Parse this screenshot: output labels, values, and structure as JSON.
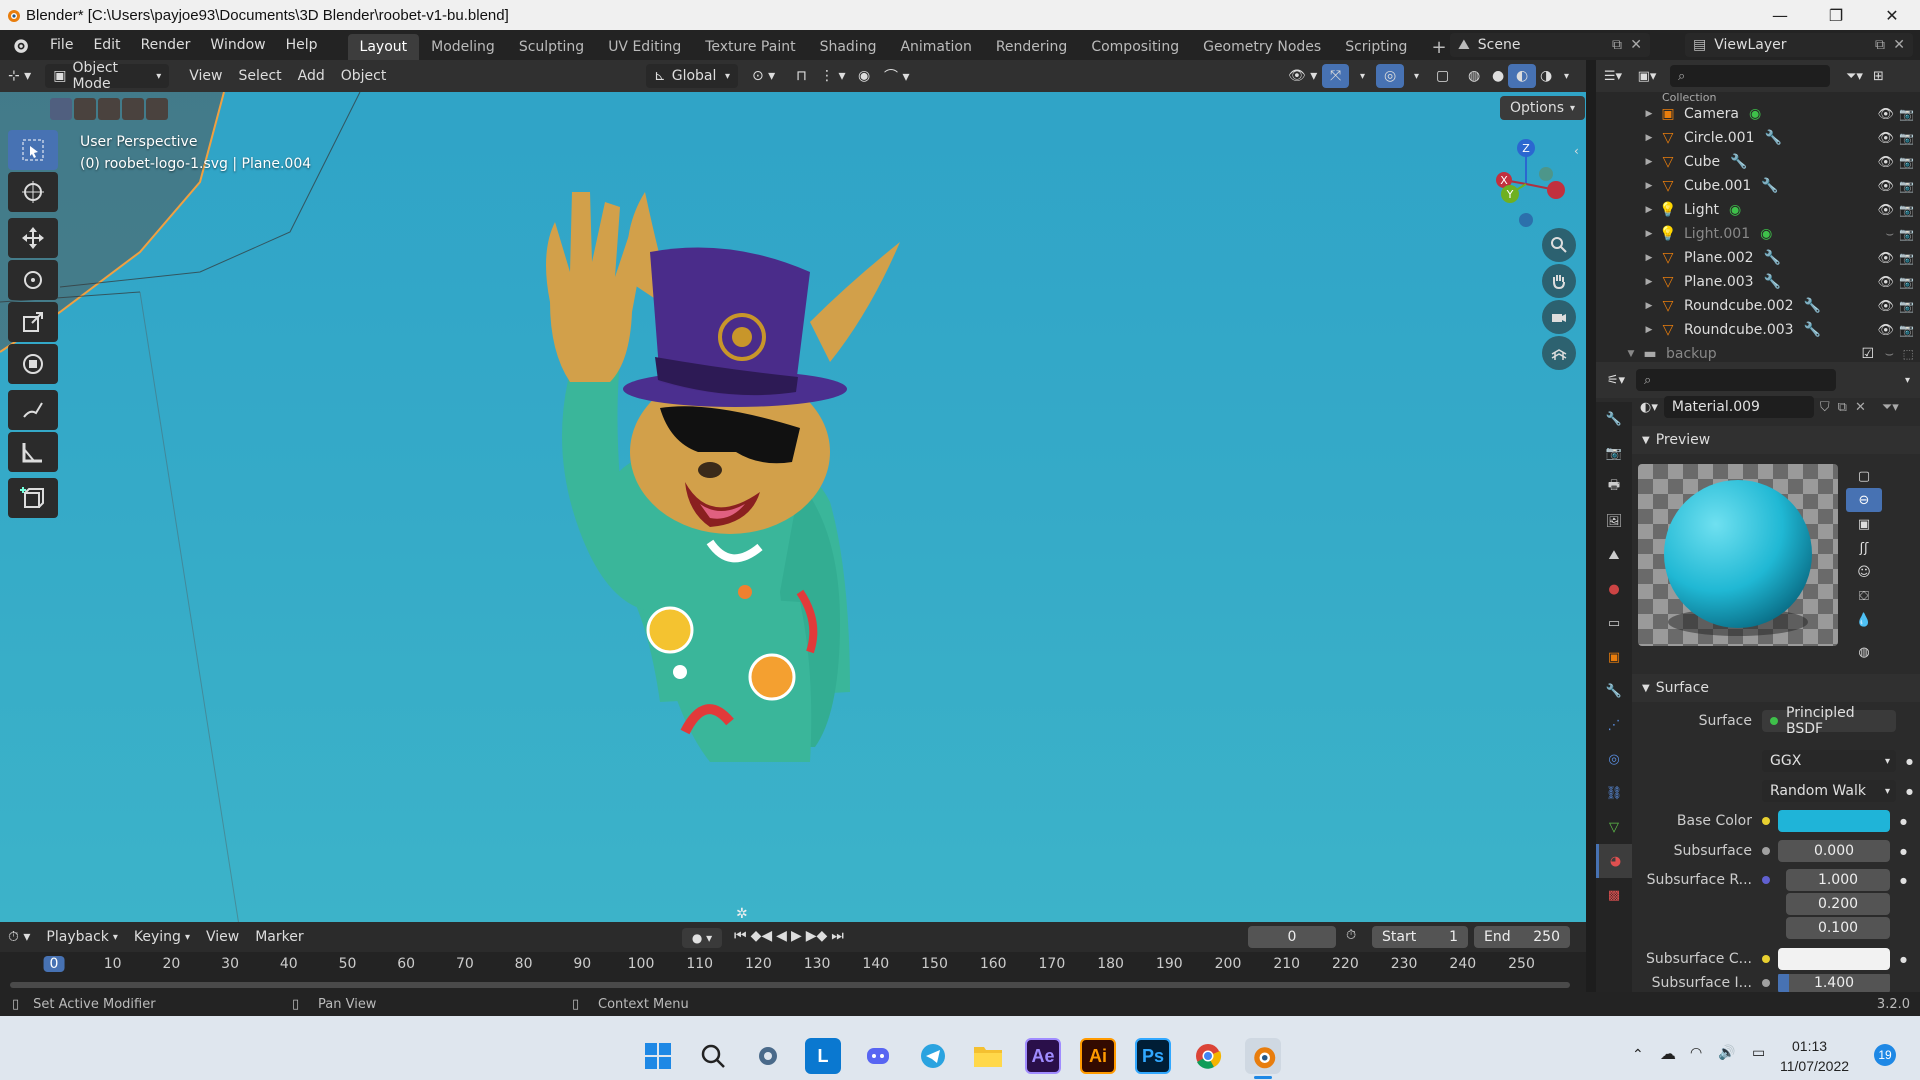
{
  "window": {
    "title": "Blender* [C:\\Users\\payjoe93\\Documents\\3D Blender\\roobet-v1-bu.blend]",
    "minimize": "—",
    "maximize": "❐",
    "close": "✕"
  },
  "menu": {
    "items": [
      "File",
      "Edit",
      "Render",
      "Window",
      "Help"
    ],
    "workspaces": [
      "Layout",
      "Modeling",
      "Sculpting",
      "UV Editing",
      "Texture Paint",
      "Shading",
      "Animation",
      "Rendering",
      "Compositing",
      "Geometry Nodes",
      "Scripting"
    ],
    "add_tab": "+",
    "scene": "Scene",
    "view_layer": "ViewLayer"
  },
  "viewport": {
    "mode": "Object Mode",
    "menus": [
      "View",
      "Select",
      "Add",
      "Object"
    ],
    "transform_orientation": "Global",
    "options_label": "Options",
    "perspective_label": "User Perspective",
    "object_label": "(0) roobet-logo-1.svg | Plane.004",
    "gizmo": {
      "x": "X",
      "y": "Y",
      "z": "Z"
    }
  },
  "outliner": {
    "top_label": "Collection",
    "items": [
      {
        "name": "Camera",
        "type": "camera"
      },
      {
        "name": "Circle.001",
        "type": "mesh"
      },
      {
        "name": "Cube",
        "type": "mesh"
      },
      {
        "name": "Cube.001",
        "type": "mesh"
      },
      {
        "name": "Light",
        "type": "light"
      },
      {
        "name": "Light.001",
        "type": "light",
        "dim": true
      },
      {
        "name": "Plane.002",
        "type": "mesh"
      },
      {
        "name": "Plane.003",
        "type": "mesh"
      },
      {
        "name": "Roundcube.002",
        "type": "mesh"
      },
      {
        "name": "Roundcube.003",
        "type": "mesh"
      }
    ],
    "collection2": "backup"
  },
  "properties": {
    "material_name": "Material.009",
    "preview_label": "Preview",
    "surface_section": "Surface",
    "surface_label": "Surface",
    "surface_value": "Principled BSDF",
    "distribution": "GGX",
    "subsurface_method": "Random Walk",
    "base_color_label": "Base Color",
    "base_color": "#1fb4d8",
    "subsurface_label": "Subsurface",
    "subsurface_value": "0.000",
    "subsurface_radius_label": "Subsurface R...",
    "subsurface_radius": [
      "1.000",
      "0.200",
      "0.100"
    ],
    "subsurface_color_label": "Subsurface C...",
    "subsurface_ior_label": "Subsurface I...",
    "subsurface_ior": "1.400"
  },
  "timeline": {
    "menus": [
      "Playback",
      "Keying",
      "View",
      "Marker"
    ],
    "current_frame": "0",
    "start_label": "Start",
    "start": "1",
    "end_label": "End",
    "end": "250",
    "ticks": [
      "0",
      "10",
      "20",
      "30",
      "40",
      "50",
      "60",
      "70",
      "80",
      "90",
      "100",
      "110",
      "120",
      "130",
      "140",
      "150",
      "160",
      "170",
      "180",
      "190",
      "200",
      "210",
      "220",
      "230",
      "240",
      "250"
    ]
  },
  "status": {
    "left": "Set Active Modifier",
    "middle": "Pan View",
    "right": "Context Menu",
    "version": "3.2.0"
  },
  "taskbar": {
    "time": "01:13",
    "date": "11/07/2022",
    "notification_count": "19",
    "apps": [
      "L",
      "Ae",
      "Ai",
      "Ps"
    ]
  }
}
